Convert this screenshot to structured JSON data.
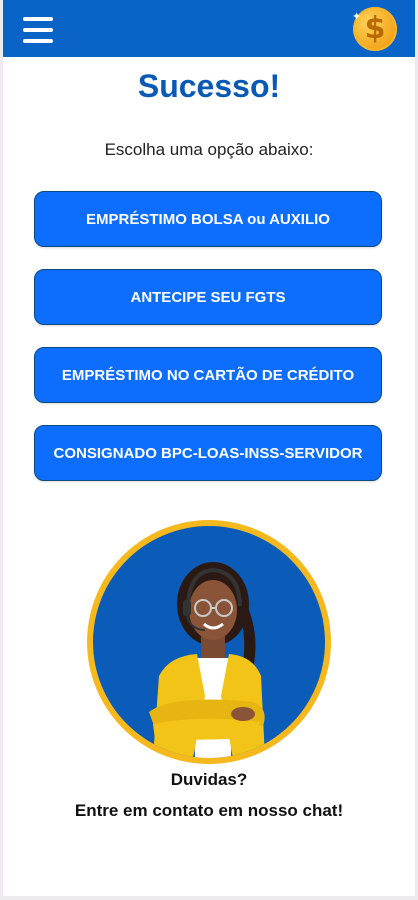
{
  "header": {
    "menu_icon": "hamburger-menu-icon",
    "coin_icon": "dollar-coin-icon",
    "coin_symbol": "$",
    "color": "#0a64c8"
  },
  "main": {
    "title": "Sucesso!",
    "subtitle": "Escolha uma opção abaixo:",
    "options": [
      {
        "label": "EMPRÉSTIMO BOLSA ou AUXILIO"
      },
      {
        "label": "ANTECIPE SEU FGTS"
      },
      {
        "label": "EMPRÉSTIMO NO CARTÃO DE CRÉDITO"
      },
      {
        "label": "CONSIGNADO BPC-LOAS-INSS-SERVIDOR"
      }
    ],
    "button_color": "#0d6efd",
    "title_color": "#0a59b5"
  },
  "support": {
    "avatar_icon": "support-agent-avatar",
    "question": "Duvidas?",
    "text": "Entre em contato em nosso chat!",
    "ring_color": "#f5b91e"
  }
}
